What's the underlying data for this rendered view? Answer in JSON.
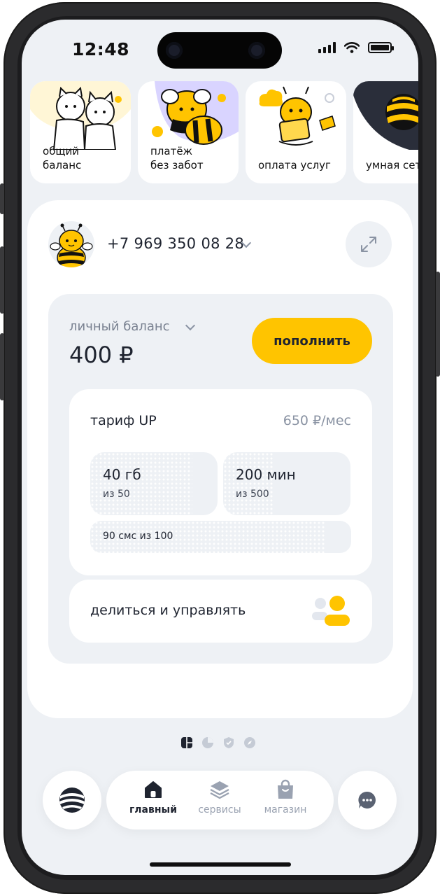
{
  "status": {
    "time": "12:48"
  },
  "stories": [
    {
      "label": "общий\nбаланс"
    },
    {
      "label": "платёж\nбез забот"
    },
    {
      "label": "оплата услуг"
    },
    {
      "label": "умная сеть"
    }
  ],
  "account": {
    "phone": "+7 969 350 08 28"
  },
  "balance": {
    "label": "личный баланс",
    "value": "400 ₽",
    "topup_label": "пополнить"
  },
  "tariff": {
    "name": "тариф UP",
    "price": "650 ₽/мес",
    "data": {
      "value": "40 гб",
      "total": "из 50",
      "fraction": 0.8
    },
    "minutes": {
      "value": "200 мин",
      "total": "из 500",
      "fraction": 0.4
    },
    "sms": {
      "text": "90 смс из 100",
      "fraction": 0.9
    }
  },
  "share": {
    "label": "делиться и управлять"
  },
  "nav": {
    "home": "главный",
    "services": "сервисы",
    "shop": "магазин"
  },
  "colors": {
    "accent": "#ffc400",
    "background": "#eef1f5",
    "text": "#1f2430",
    "muted": "#8a93a3"
  }
}
